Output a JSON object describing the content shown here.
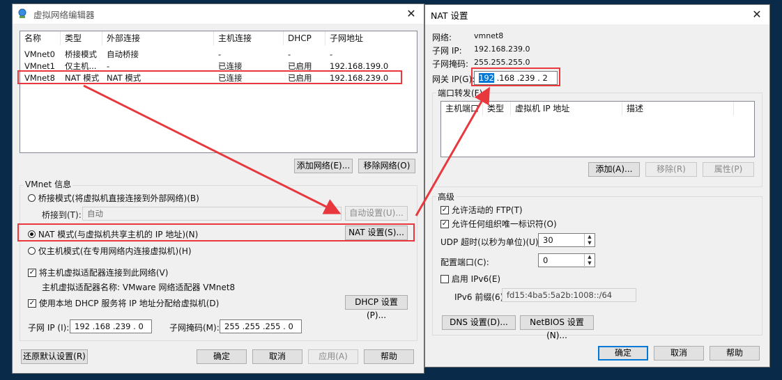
{
  "vne": {
    "title": "虚拟网络编辑器",
    "columns": [
      "名称",
      "类型",
      "外部连接",
      "主机连接",
      "DHCP",
      "子网地址"
    ],
    "rows": [
      [
        "VMnet0",
        "桥接模式",
        "自动桥接",
        "-",
        "-",
        "-"
      ],
      [
        "VMnet1",
        "仅主机...",
        "-",
        "已连接",
        "已启用",
        "192.168.199.0"
      ],
      [
        "VMnet8",
        "NAT 模式",
        "NAT 模式",
        "已连接",
        "已启用",
        "192.168.239.0"
      ]
    ],
    "add_network": "添加网络(E)...",
    "remove_network": "移除网络(O)",
    "vmnet_info": "VMnet 信息",
    "bridge_mode": "桥接模式(将虚拟机直接连接到外部网络)(B)",
    "bridge_to_label": "桥接到(T):",
    "bridge_to_value": "自动",
    "auto_settings": "自动设置(U)...",
    "nat_mode": "NAT 模式(与虚拟机共享主机的 IP 地址)(N)",
    "nat_settings": "NAT 设置(S)...",
    "hostonly_mode": "仅主机模式(在专用网络内连接虚拟机)(H)",
    "connect_adapter": "将主机虚拟适配器连接到此网络(V)",
    "adapter_name": "主机虚拟适配器名称: VMware 网络适配器 VMnet8",
    "use_dhcp": "使用本地 DHCP 服务将 IP 地址分配给虚拟机(D)",
    "dhcp_settings": "DHCP 设置(P)...",
    "subnet_ip_label": "子网 IP (I):",
    "subnet_ip": "192 .168 .239 .  0",
    "subnet_mask_label": "子网掩码(M):",
    "subnet_mask": "255 .255 .255 .  0",
    "restore_defaults": "还原默认设置(R)",
    "ok": "确定",
    "cancel": "取消",
    "apply": "应用(A)",
    "help": "帮助"
  },
  "nat": {
    "title": "NAT 设置",
    "network_label": "网络:",
    "network_value": "vmnet8",
    "subnet_ip_label": "子网 IP:",
    "subnet_ip_value": "192.168.239.0",
    "subnet_mask_label": "子网掩码:",
    "subnet_mask_value": "255.255.255.0",
    "gateway_label": "网关 IP(G):",
    "gateway_sel": "192",
    "gateway_rest": " .168 .239 .  2",
    "port_forward": "端口转发(F)",
    "pf_columns": [
      "主机端口",
      "类型",
      "虚拟机 IP 地址",
      "描述"
    ],
    "pf_add": "添加(A)...",
    "pf_remove": "移除(R)",
    "pf_props": "属性(P)",
    "advanced": "高级",
    "allow_ftp": "允许活动的 FTP(T)",
    "allow_uuid": "允许任何组织唯一标识符(O)",
    "udp_timeout_label": "UDP 超时(以秒为单位)(U):",
    "udp_timeout": "30",
    "config_port_label": "配置端口(C):",
    "config_port": "0",
    "enable_ipv6": "启用 IPv6(E)",
    "ipv6_prefix_label": "IPv6 前缀(6):",
    "ipv6_prefix": "fd15:4ba5:5a2b:1008::/64",
    "dns_settings": "DNS 设置(D)...",
    "netbios_settings": "NetBIOS 设置(N)...",
    "ok": "确定",
    "cancel": "取消",
    "help": "帮助"
  },
  "annotation_color": "#e8383d"
}
